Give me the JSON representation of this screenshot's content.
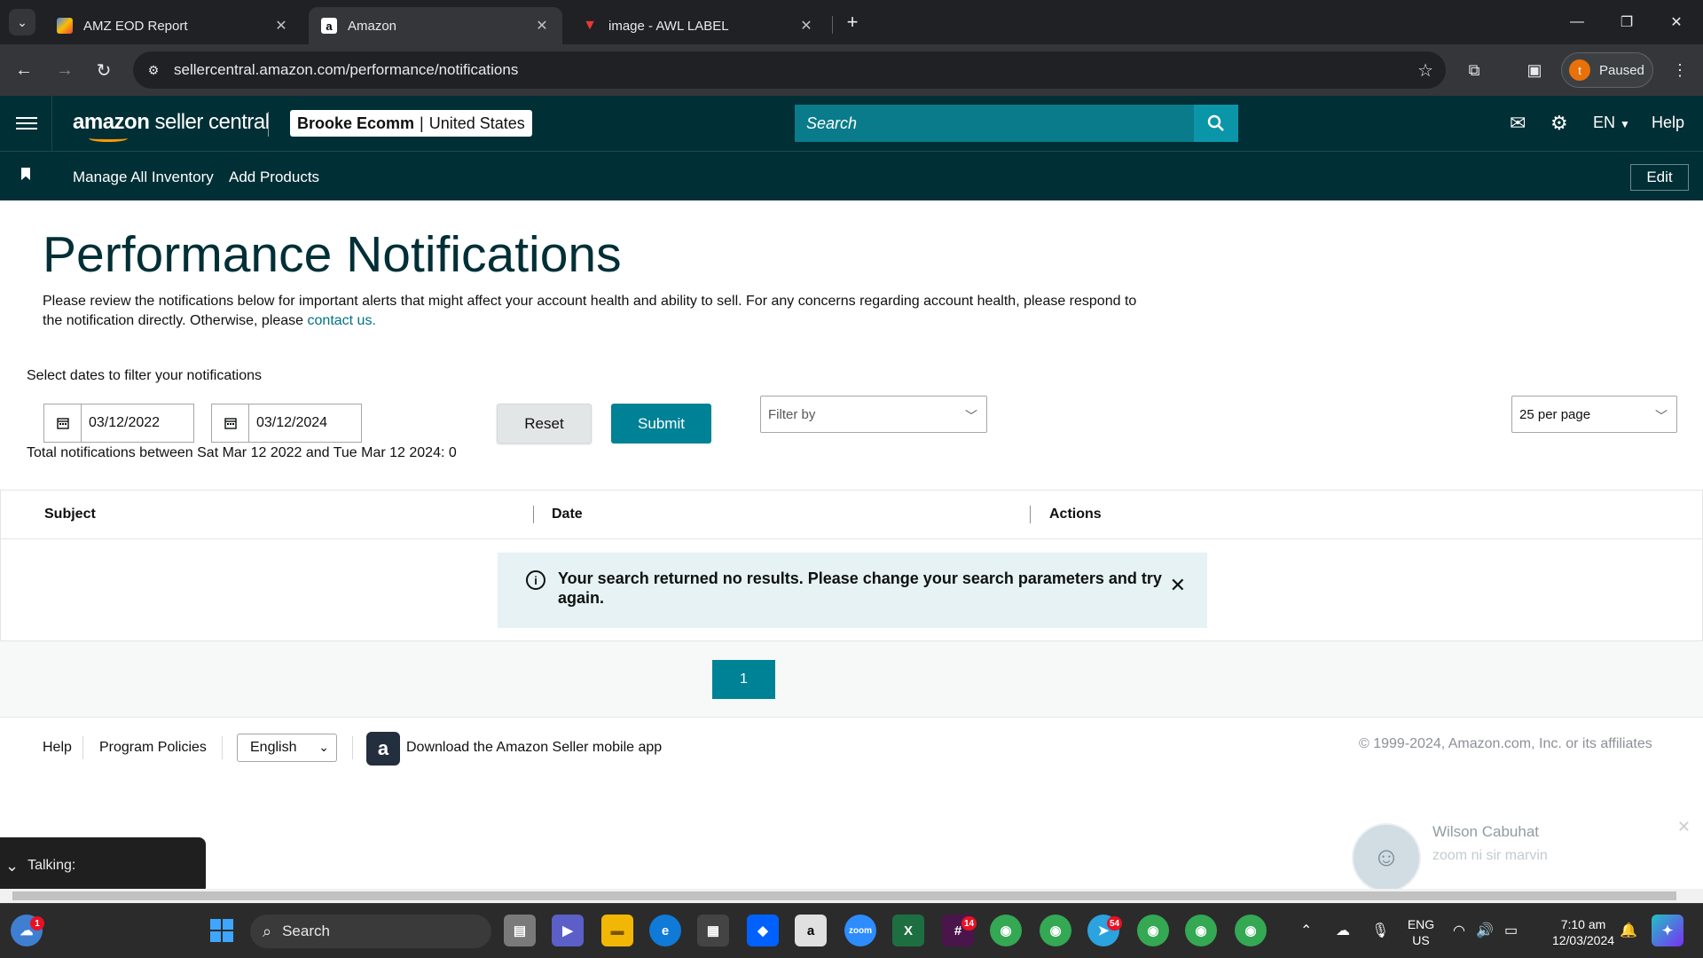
{
  "browser": {
    "tabs": [
      {
        "title": "AMZ EOD Report",
        "icon": "amz-eod-icon"
      },
      {
        "title": "Amazon",
        "icon": "amazon-a-icon"
      },
      {
        "title": "image - AWL LABEL",
        "icon": "awl-label-icon"
      }
    ],
    "url": "sellercentral.amazon.com/performance/notifications",
    "profile_initial": "t",
    "profile_status": "Paused"
  },
  "header": {
    "logo_amazon": "amazon",
    "logo_rest": " seller central",
    "account_name": "Brooke Ecomm",
    "account_sep": "|",
    "account_region": "United States",
    "search_placeholder": "Search",
    "language": "EN",
    "help": "Help"
  },
  "subnav": {
    "links": [
      "Manage All Inventory",
      "Add Products"
    ],
    "edit": "Edit"
  },
  "main": {
    "title": "Performance Notifications",
    "description": "Please review the notifications below for important alerts that might affect your account health and ability to sell. For any concerns regarding account health, please respond to the notification directly. Otherwise, please ",
    "contact_link": "contact us.",
    "filter_label": "Select dates to filter your notifications",
    "date_from": "03/12/2022",
    "date_to": "03/12/2024",
    "reset": "Reset",
    "submit": "Submit",
    "filter_by": "Filter by",
    "per_page": "25 per page",
    "total": "Total notifications between Sat Mar 12 2022 and Tue Mar 12 2024: 0",
    "columns": [
      "Subject",
      "Date",
      "Actions"
    ],
    "alert": "Your search returned no results. Please change your search parameters and try again.",
    "page": "1"
  },
  "footer": {
    "help": "Help",
    "policies": "Program Policies",
    "language": "English",
    "app_link": "Download the Amazon Seller mobile app",
    "copyright": "© 1999-2024, Amazon.com, Inc. or its affiliates"
  },
  "overlay": {
    "talking": "Talking:",
    "chat_name": "Wilson Cabuhat",
    "chat_message": "zoom ni sir marvin"
  },
  "taskbar": {
    "search": "Search",
    "lang_line1": "ENG",
    "lang_line2": "US",
    "time": "7:10 am",
    "date": "12/03/2024",
    "badges": {
      "weather": "1",
      "slack": "14",
      "telegram": "54"
    }
  },
  "colors": {
    "brand_dark": "#002f36",
    "accent_teal": "#008296",
    "alert_bg": "#e6f2f3",
    "link": "#007185"
  }
}
